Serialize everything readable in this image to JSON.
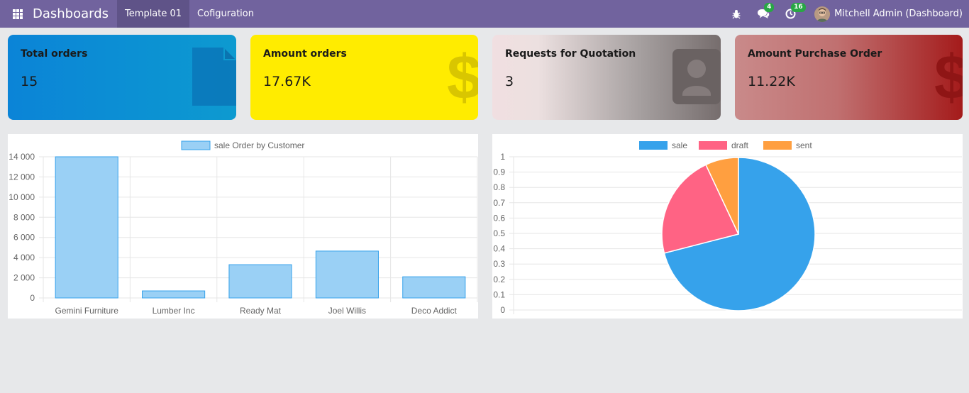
{
  "navbar": {
    "brand": "Dashboards",
    "menu": [
      "Template 01",
      "Cofiguration"
    ],
    "chat_count": "4",
    "activity_count": "16",
    "user": "Mitchell Admin (Dashboard)"
  },
  "cards": [
    {
      "title": "Total orders",
      "value": "15",
      "icon": "document-icon"
    },
    {
      "title": "Amount orders",
      "value": "17.67K",
      "icon": "dollar-icon"
    },
    {
      "title": "Requests for Quotation",
      "value": "3",
      "icon": "user-icon"
    },
    {
      "title": "Amount Purchase Order",
      "value": "11.22K",
      "icon": "dollar-icon"
    }
  ],
  "chart_data": [
    {
      "type": "bar",
      "legend": [
        "sale Order by Customer"
      ],
      "categories": [
        "Gemini Furniture",
        "Lumber Inc",
        "Ready Mat",
        "Joel Willis",
        "Deco Addict"
      ],
      "series": [
        {
          "name": "sale Order by Customer",
          "values": [
            14000,
            700,
            3300,
            4650,
            2100
          ]
        }
      ],
      "yticks": [
        "0",
        "2 000",
        "4 000",
        "6 000",
        "8 000",
        "10 000",
        "12 000",
        "14 000"
      ],
      "ylim": [
        0,
        14000
      ],
      "grid": true,
      "color": "#9ad0f5",
      "border_color": "#36a2eb"
    },
    {
      "type": "pie",
      "legend": [
        "sale",
        "draft",
        "sent"
      ],
      "slices": [
        {
          "label": "sale",
          "value": 0.71,
          "color": "#36a2eb"
        },
        {
          "label": "draft",
          "value": 0.22,
          "color": "#ff6384"
        },
        {
          "label": "sent",
          "value": 0.07,
          "color": "#ff9f40"
        }
      ],
      "yticks": [
        "0",
        "0.1",
        "0.2",
        "0.3",
        "0.4",
        "0.5",
        "0.6",
        "0.7",
        "0.8",
        "0.9",
        "1"
      ],
      "ylim": [
        0,
        1
      ],
      "grid": true
    }
  ]
}
